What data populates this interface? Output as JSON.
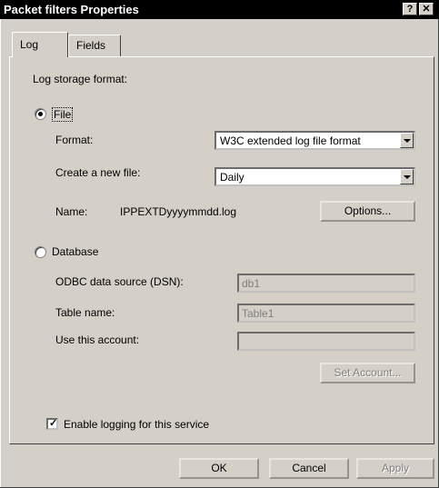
{
  "window": {
    "title": "Packet filters Properties",
    "help_label": "?",
    "close_label": "✕"
  },
  "tabs": [
    {
      "label": "Log",
      "active": true
    },
    {
      "label": "Fields",
      "active": false
    }
  ],
  "log": {
    "storage_format_label": "Log storage format:",
    "file": {
      "radio_label": "File",
      "selected": true,
      "format_label": "Format:",
      "format_value": "W3C extended log file format",
      "new_file_label": "Create a new file:",
      "new_file_value": "Daily",
      "name_label": "Name:",
      "name_value": "IPPEXTDyyyymmdd.log",
      "options_button": "Options..."
    },
    "database": {
      "radio_label": "Database",
      "selected": false,
      "odbc_label": "ODBC data source (DSN):",
      "odbc_value": "db1",
      "table_label": "Table name:",
      "table_value": "Table1",
      "account_label": "Use this account:",
      "account_value": "",
      "set_account_button": "Set Account..."
    },
    "enable_logging_label": "Enable logging for this service",
    "enable_logging_checked": true
  },
  "buttons": {
    "ok": "OK",
    "cancel": "Cancel",
    "apply": "Apply"
  }
}
